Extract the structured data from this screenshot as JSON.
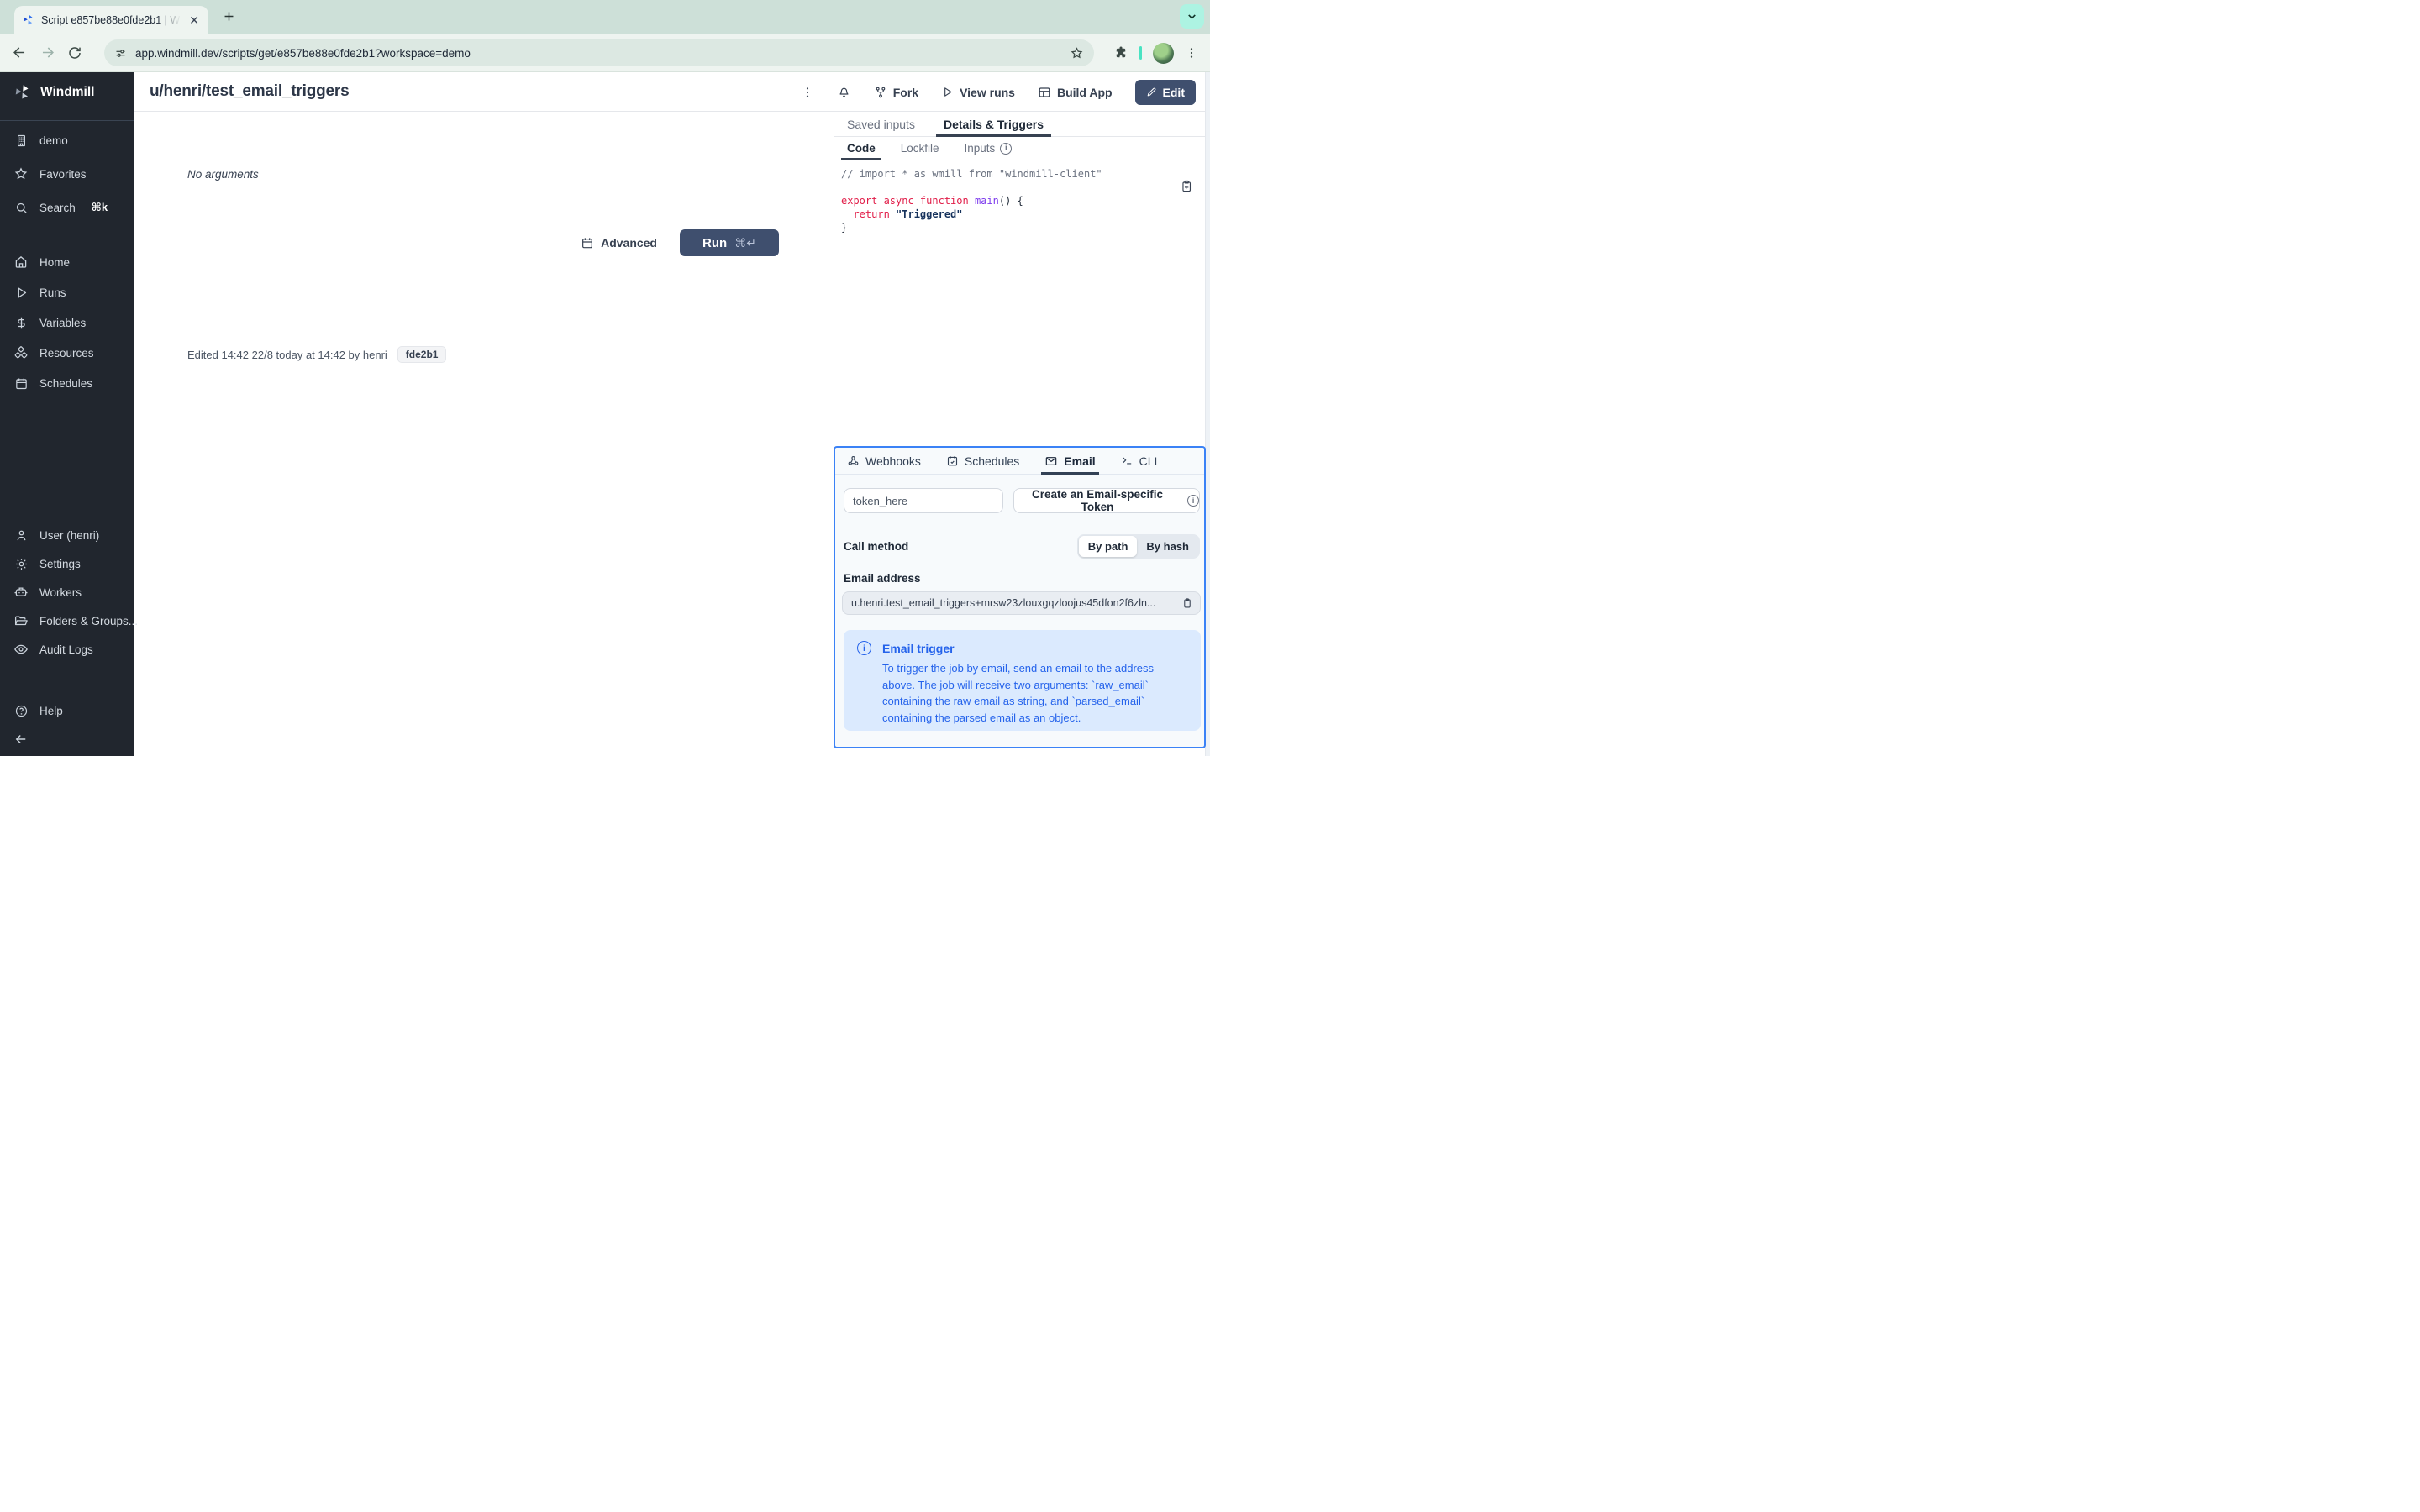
{
  "browser": {
    "tab_title": "Script e857be88e0fde2b1 | W",
    "url": "app.windmill.dev/scripts/get/e857be88e0fde2b1?workspace=demo"
  },
  "sidebar": {
    "brand": "Windmill",
    "items": [
      {
        "label": "demo",
        "icon": "building"
      },
      {
        "label": "Favorites",
        "icon": "star"
      },
      {
        "label": "Search",
        "icon": "magnifier",
        "kbd": "⌘k"
      },
      {
        "label": "Home",
        "icon": "house"
      },
      {
        "label": "Runs",
        "icon": "play"
      },
      {
        "label": "Variables",
        "icon": "dollar"
      },
      {
        "label": "Resources",
        "icon": "cubes"
      },
      {
        "label": "Schedules",
        "icon": "calendar"
      },
      {
        "label": "User (henri)",
        "icon": "person"
      },
      {
        "label": "Settings",
        "icon": "gear"
      },
      {
        "label": "Workers",
        "icon": "robot"
      },
      {
        "label": "Folders & Groups...",
        "icon": "folder"
      },
      {
        "label": "Audit Logs",
        "icon": "eye"
      },
      {
        "label": "Help",
        "icon": "question"
      }
    ]
  },
  "header": {
    "title": "u/henri/test_email_triggers",
    "actions": {
      "fork": "Fork",
      "view_runs": "View runs",
      "build_app": "Build App",
      "edit": "Edit"
    }
  },
  "main": {
    "no_arguments": "No arguments",
    "advanced": "Advanced",
    "run": "Run",
    "run_kbd": "⌘↵",
    "edited": "Edited 14:42 22/8 today at 14:42 by henri",
    "version_badge": "fde2b1"
  },
  "panel": {
    "tabs": {
      "saved_inputs": "Saved inputs",
      "details": "Details & Triggers"
    },
    "subtabs": {
      "code": "Code",
      "lockfile": "Lockfile",
      "inputs": "Inputs"
    },
    "code": {
      "l1": "// import * as wmill from \"windmill-client\"",
      "l3_kw": "export async function ",
      "l3_fn": "main",
      "l3_pl": "() {",
      "l4_ind": "  ",
      "l4_kw": "return ",
      "l4_str": "\"Triggered\"",
      "l5": "}"
    }
  },
  "triggers": {
    "tabs": {
      "webhooks": "Webhooks",
      "schedules": "Schedules",
      "email": "Email",
      "cli": "CLI"
    },
    "token_value": "token_here",
    "create_token": "Create an Email-specific Token",
    "call_method_label": "Call method",
    "by_path": "By path",
    "by_hash": "By hash",
    "email_address_label": "Email address",
    "email_value": "u.henri.test_email_triggers+mrsw23zlouxgqzloojus45dfon2f6zln...",
    "info_title": "Email trigger",
    "info_body": "To trigger the job by email, send an email to the address above. The job will receive two arguments: `raw_email` containing the raw email as string, and `parsed_email` containing the parsed email as an object."
  },
  "colors": {
    "accent_blue": "#3b82f6",
    "navy_button": "#3f4f6e",
    "sidebar_bg": "#21262e",
    "info_bg": "#dbeafe",
    "info_text": "#2563eb",
    "chrome_mint": "#cde0d8",
    "teal_accent": "#49e3c2"
  }
}
